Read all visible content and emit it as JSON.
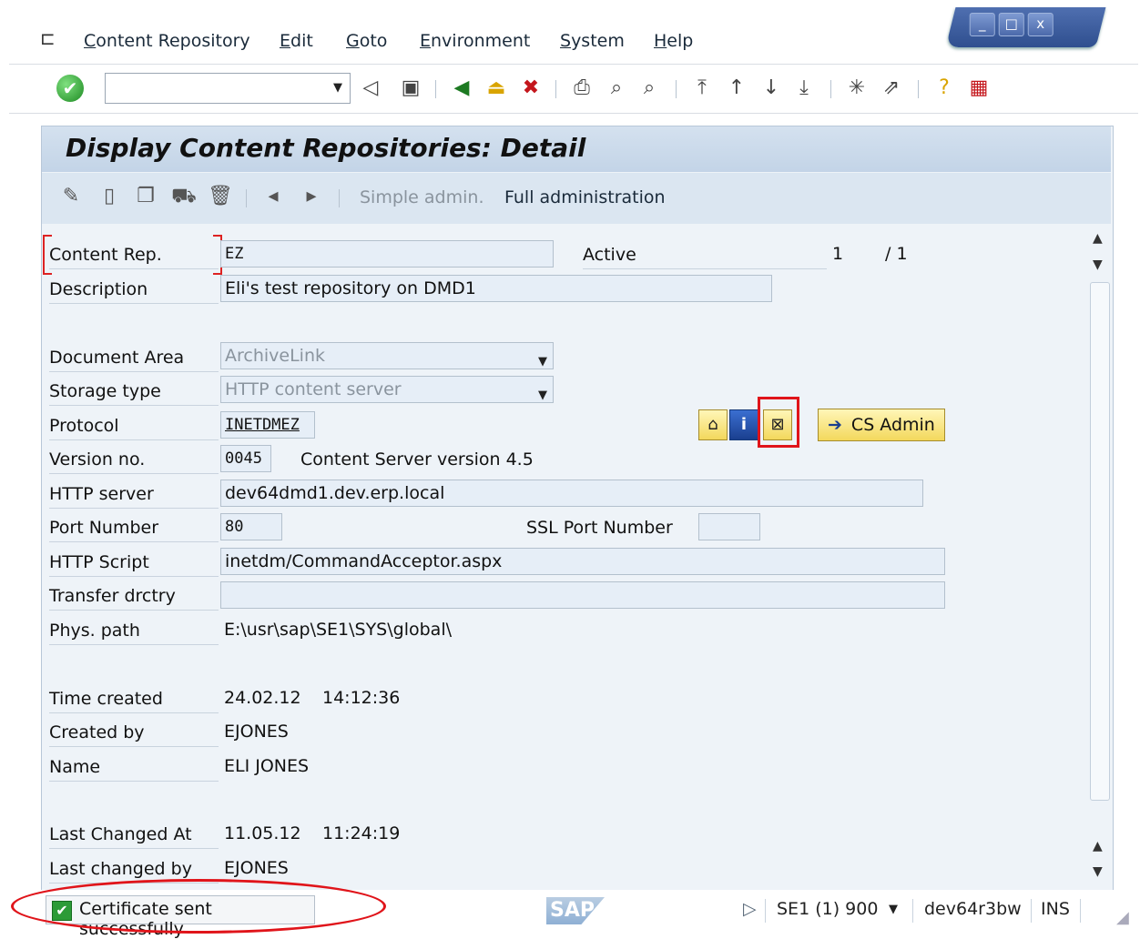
{
  "menu": {
    "items": [
      "Content Repository",
      "Edit",
      "Goto",
      "Environment",
      "System",
      "Help"
    ]
  },
  "window_controls": {
    "minimize": "_",
    "maximize": "□",
    "close": "x"
  },
  "toolbar": {
    "command_value": ""
  },
  "page": {
    "title": "Display Content Repositories: Detail"
  },
  "app_toolbar": {
    "simple_admin": "Simple admin.",
    "full_admin": "Full administration"
  },
  "form": {
    "content_rep_label": "Content Rep.",
    "content_rep_value": "EZ",
    "active_label": "Active",
    "page_current": "1",
    "page_total": "/ 1",
    "description_label": "Description",
    "description_value": "Eli's test repository on DMD1",
    "doc_area_label": "Document Area",
    "doc_area_value": "ArchiveLink",
    "storage_type_label": "Storage type",
    "storage_type_value": "HTTP content server",
    "protocol_label": "Protocol",
    "protocol_value": "INETDMEZ",
    "cs_admin_label": "CS Admin",
    "version_label": "Version no.",
    "version_value": "0045",
    "version_text": "Content Server version 4.5",
    "http_server_label": "HTTP server",
    "http_server_value": "dev64dmd1.dev.erp.local",
    "port_label": "Port Number",
    "port_value": "80",
    "ssl_port_label": "SSL Port Number",
    "ssl_port_value": "",
    "script_label": "HTTP Script",
    "script_value": "inetdm/CommandAcceptor.aspx",
    "transfer_label": "Transfer drctry",
    "transfer_value": "",
    "phys_path_label": "Phys. path",
    "phys_path_value": "E:\\usr\\sap\\SE1\\SYS\\global\\",
    "time_created_label": "Time created",
    "time_created_date": "24.02.12",
    "time_created_time": "14:12:36",
    "created_by_label": "Created by",
    "created_by_value": "EJONES",
    "name_label": "Name",
    "name_value": "ELI JONES",
    "last_changed_at_label": "Last Changed At",
    "last_changed_at_date": "11.05.12",
    "last_changed_at_time": "11:24:19",
    "last_changed_by_label": "Last changed by",
    "last_changed_by_value": "EJONES"
  },
  "status": {
    "message": "Certificate sent successfully",
    "logo": "SAP",
    "system": "SE1 (1) 900",
    "server": "dev64r3bw",
    "mode": "INS"
  }
}
